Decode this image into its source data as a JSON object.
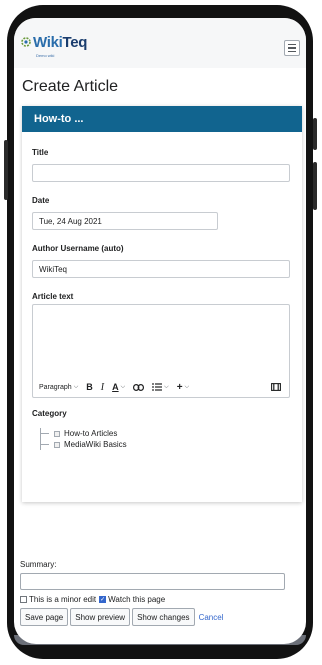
{
  "header": {
    "logo_main": "Wiki",
    "logo_accent": "Teq",
    "logo_tagline": "Demo wiki",
    "menu_icon": "hamburger-icon"
  },
  "page": {
    "title": "Create Article"
  },
  "form": {
    "header": "How-to ...",
    "title_label": "Title",
    "title_value": "",
    "date_label": "Date",
    "date_value": "Tue, 24 Aug 2021",
    "author_label": "Author Username (auto)",
    "author_value": "WikiTeq",
    "article_label": "Article text",
    "toolbar": {
      "paragraph": "Paragraph",
      "bold": "B",
      "italic": "I",
      "text_style": "A",
      "link_icon": "link-icon",
      "list_icon": "bullet-list-icon",
      "insert": "+",
      "special_icon": "special-char-icon"
    },
    "category_label": "Category",
    "categories": [
      {
        "label": "How-to Articles",
        "checked": false
      },
      {
        "label": "MediaWiki Basics",
        "checked": false
      }
    ]
  },
  "editor": {
    "summary_label": "Summary:",
    "summary_value": "",
    "minor_edit_label": "This is a minor edit",
    "minor_edit_checked": false,
    "watch_label": "Watch this page",
    "watch_checked": true,
    "save_button": "Save page",
    "preview_button": "Show preview",
    "changes_button": "Show changes",
    "cancel_link": "Cancel"
  },
  "colors": {
    "form_header": "#11648f",
    "link": "#3366cc",
    "phone_frame": "#121212"
  }
}
